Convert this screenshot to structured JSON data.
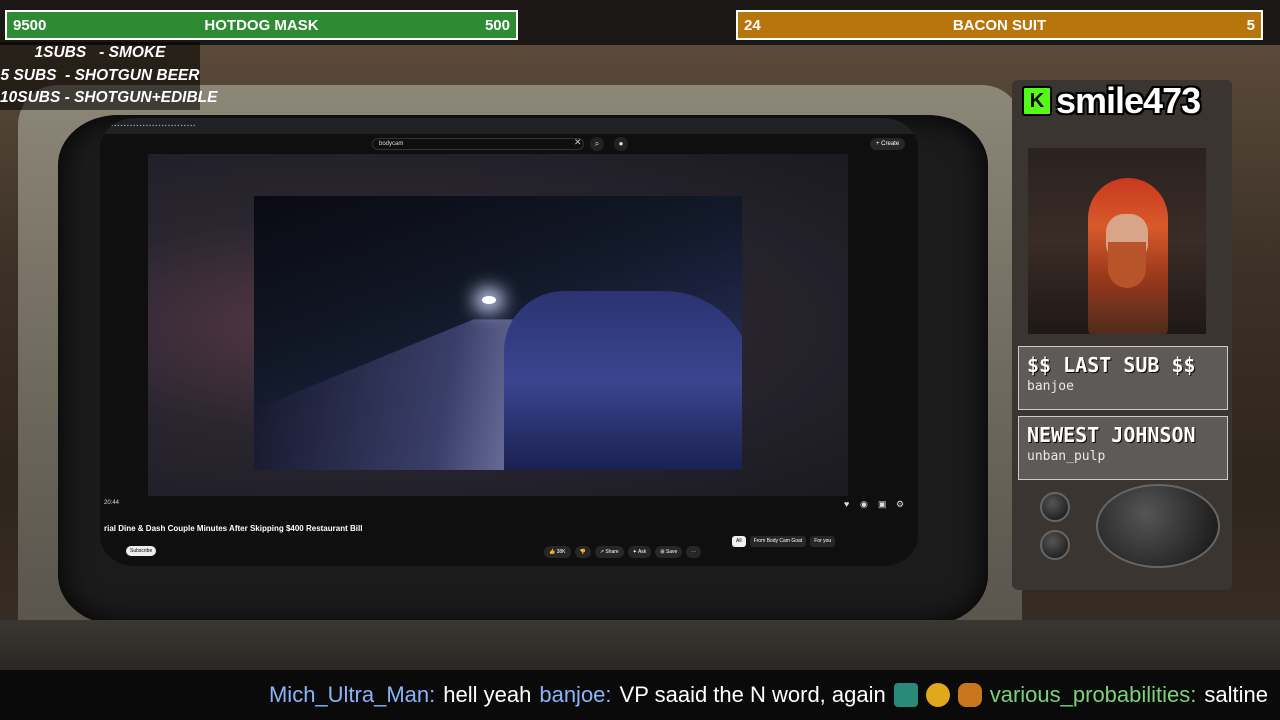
{
  "goals": {
    "left": {
      "count": "9500",
      "name": "HOTDOG MASK",
      "target": "500",
      "color": "#2e8b34"
    },
    "right": {
      "count": "24",
      "name": "BACON SUIT",
      "target": "5",
      "color": "#b8750c"
    }
  },
  "sub_list": [
    "1SUBS   - SMOKE",
    "5 SUBS  - SHOTGUN BEER",
    "10SUBS - SHOTGUN+EDIBLE"
  ],
  "browser": {
    "search_value": "bodycam",
    "create_label": "+ Create",
    "time": "20:44",
    "video_title": "rial Dine & Dash Couple Minutes After Skipping $400 Restaurant Bill",
    "subscribe": "Subscribe",
    "actions": [
      "👍 38K",
      "👎",
      "↗ Share",
      "✦ Ask",
      "⊞ Save",
      "⋯"
    ],
    "chips": [
      "All",
      "From Body Cam Goat",
      "For you"
    ]
  },
  "channel": {
    "name": "smile473",
    "platform_icon": "K",
    "accent": "#53fc18"
  },
  "last_sub": {
    "title": "$$ LAST SUB $$",
    "value": "banjoe"
  },
  "newest": {
    "title": "NEWEST JOHNSON",
    "value": "unban_pulp"
  },
  "chat": [
    {
      "user": "Mich_Ultra_Man:",
      "message": "hell yeah"
    },
    {
      "user": "banjoe:",
      "message": "VP saaid the N word, again"
    },
    {
      "user": "various_probabilities:",
      "message": "saltine"
    }
  ]
}
